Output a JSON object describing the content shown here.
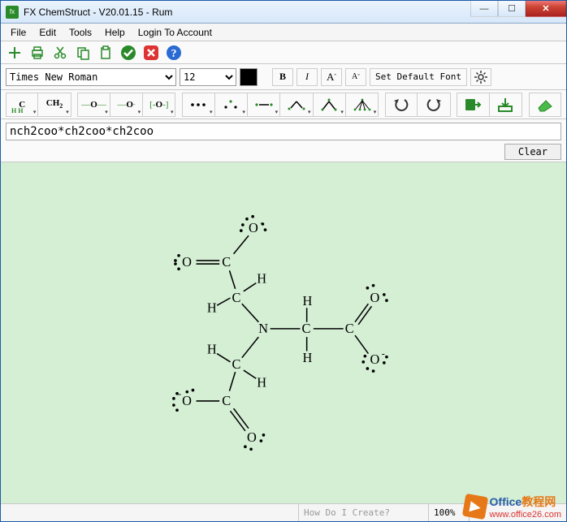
{
  "window": {
    "title": "FX ChemStruct - V20.01.15 - Rum"
  },
  "menu": {
    "file": "File",
    "edit": "Edit",
    "tools": "Tools",
    "help": "Help",
    "login": "Login To Account"
  },
  "font": {
    "name": "Times New Roman",
    "size": "12",
    "bold": "B",
    "italic": "I",
    "supA": "A",
    "subA": "A",
    "setdefault": "Set Default Font"
  },
  "chembar": {
    "ch": "C",
    "ch2": "CH₂",
    "o1": "O",
    "o2": "O",
    "o3": "[O]"
  },
  "formula": "nch2coo*ch2coo*ch2coo",
  "clear": "Clear",
  "status": {
    "how": "How Do I Create?",
    "zoom": "100%"
  },
  "watermark": {
    "big": "Office",
    "small": "教程网",
    "url": "www.office26.com"
  }
}
